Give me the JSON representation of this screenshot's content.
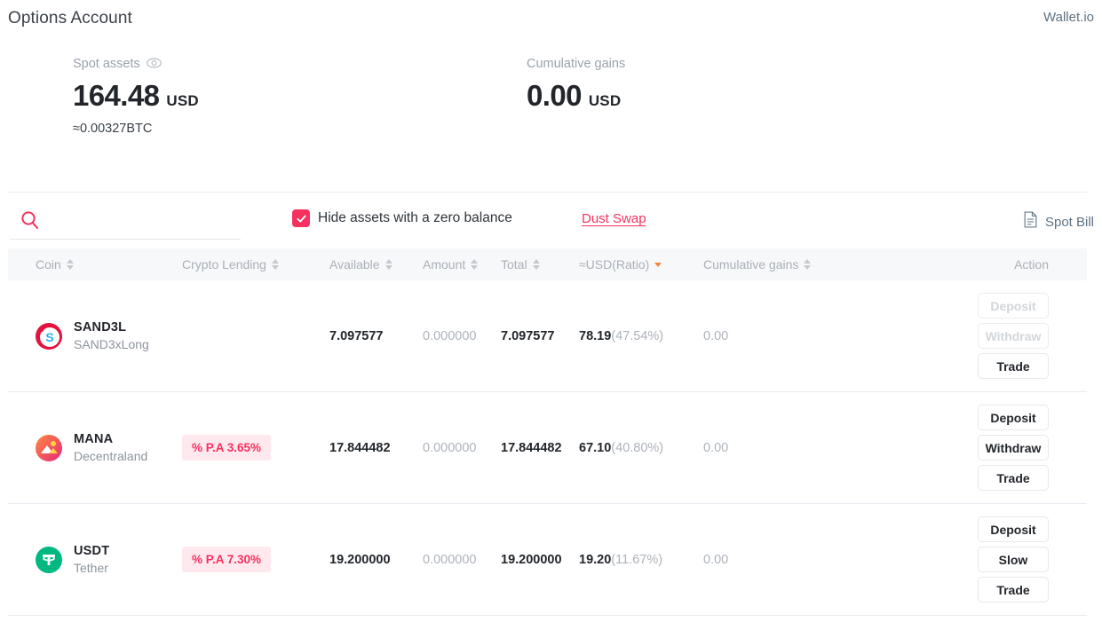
{
  "header": {
    "title": "Options Account",
    "brand": "Wallet.io"
  },
  "summary": {
    "spot": {
      "label": "Spot assets",
      "eye_icon": "eye-icon",
      "value": "164.48",
      "currency": "USD",
      "sub": "≈0.00327BTC"
    },
    "gains": {
      "label": "Cumulative gains",
      "value": "0.00",
      "currency": "USD"
    }
  },
  "toolbar": {
    "search_icon": "search-icon",
    "search_value": "",
    "search_placeholder": "",
    "hide_zero_label": "Hide assets with a zero balance",
    "hide_zero_checked": true,
    "dust_swap_label": "Dust Swap",
    "spot_bill_label": "Spot Bill",
    "spot_bill_icon": "document-icon"
  },
  "table": {
    "columns": [
      {
        "key": "coin",
        "label": "Coin",
        "sortable": true,
        "sort": "none"
      },
      {
        "key": "lending",
        "label": "Crypto Lending",
        "sortable": true,
        "sort": "none"
      },
      {
        "key": "avail",
        "label": "Available",
        "sortable": true,
        "sort": "none"
      },
      {
        "key": "amount",
        "label": "Amount",
        "sortable": true,
        "sort": "none"
      },
      {
        "key": "total",
        "label": "Total",
        "sortable": true,
        "sort": "none"
      },
      {
        "key": "usd",
        "label": "≈USD(Ratio)",
        "sortable": true,
        "sort": "desc"
      },
      {
        "key": "gains",
        "label": "Cumulative gains",
        "sortable": true,
        "sort": "none"
      },
      {
        "key": "action",
        "label": "Action",
        "sortable": false,
        "sort": "none"
      }
    ],
    "rows": [
      {
        "symbol": "SAND3L",
        "name": "SAND3xLong",
        "logo": "sand3l-icon",
        "lending": "",
        "available": "7.097577",
        "amount": "0.000000",
        "total": "7.097577",
        "usd": "78.19",
        "ratio": "(47.54%)",
        "gains": "0.00",
        "buttons": [
          {
            "label": "Deposit",
            "enabled": false
          },
          {
            "label": "Withdraw",
            "enabled": false
          },
          {
            "label": "Trade",
            "enabled": true
          }
        ]
      },
      {
        "symbol": "MANA",
        "name": "Decentraland",
        "logo": "mana-icon",
        "lending": "% P.A 3.65%",
        "available": "17.844482",
        "amount": "0.000000",
        "total": "17.844482",
        "usd": "67.10",
        "ratio": "(40.80%)",
        "gains": "0.00",
        "buttons": [
          {
            "label": "Deposit",
            "enabled": true
          },
          {
            "label": "Withdraw",
            "enabled": true
          },
          {
            "label": "Trade",
            "enabled": true
          }
        ]
      },
      {
        "symbol": "USDT",
        "name": "Tether",
        "logo": "usdt-icon",
        "lending": "% P.A 7.30%",
        "available": "19.200000",
        "amount": "0.000000",
        "total": "19.200000",
        "usd": "19.20",
        "ratio": "(11.67%)",
        "gains": "0.00",
        "buttons": [
          {
            "label": "Deposit",
            "enabled": true
          },
          {
            "label": "Slow",
            "enabled": true
          },
          {
            "label": "Trade",
            "enabled": true
          }
        ]
      }
    ]
  },
  "colors": {
    "accent": "#f7315f",
    "badge_bg": "#ffe9ef",
    "sort_active": "#f7853a",
    "brand_text": "#5d7180"
  }
}
